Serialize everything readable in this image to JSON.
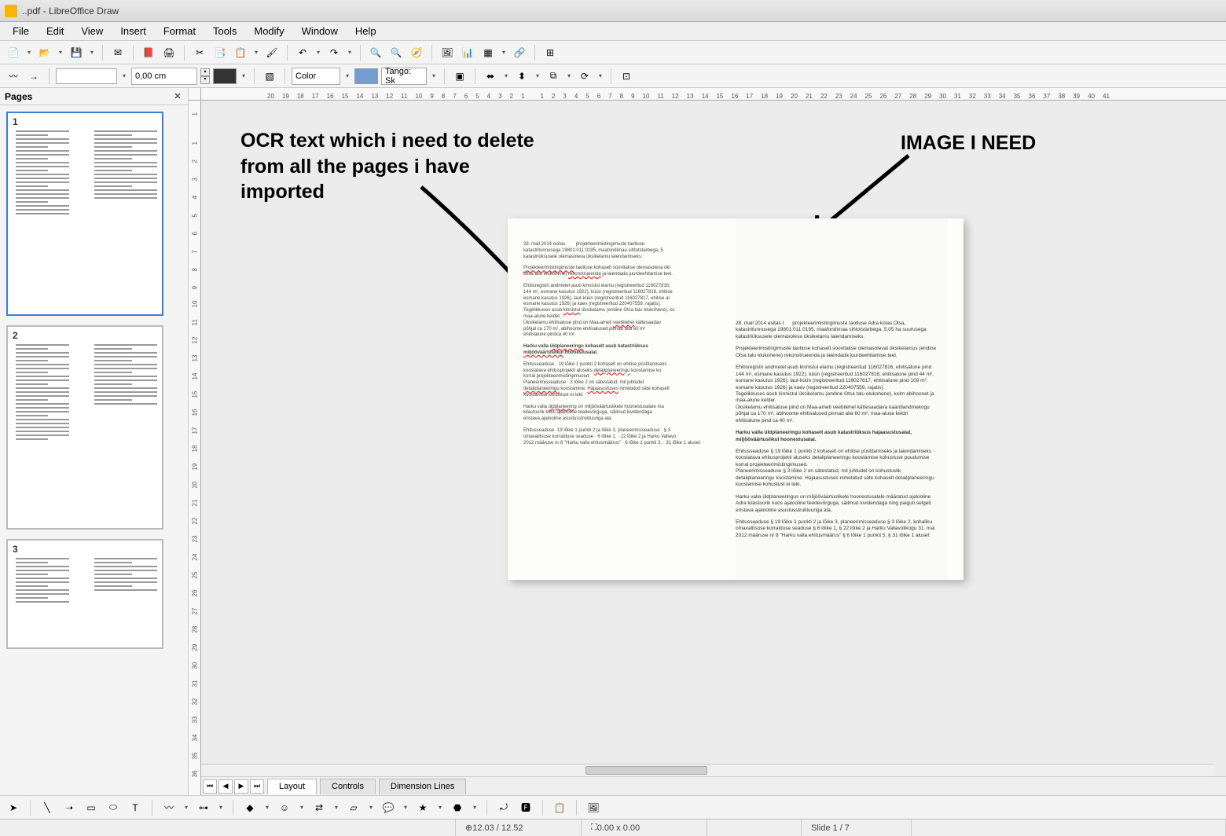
{
  "window": {
    "title": "..pdf - LibreOffice Draw"
  },
  "menu": [
    "File",
    "Edit",
    "View",
    "Insert",
    "Format",
    "Tools",
    "Modify",
    "Window",
    "Help"
  ],
  "toolbar2": {
    "line_width": "0,00 cm",
    "fill_type": "Color",
    "fill_name": "Tango: Sk",
    "fill_color": "#729fcf"
  },
  "pages_panel": {
    "title": "Pages",
    "page_numbers": [
      "1",
      "2",
      "3"
    ]
  },
  "ruler_h": [
    "20",
    "19",
    "18",
    "17",
    "16",
    "15",
    "14",
    "13",
    "12",
    "11",
    "10",
    "9",
    "8",
    "7",
    "6",
    "5",
    "4",
    "3",
    "2",
    "1",
    "",
    "1",
    "2",
    "3",
    "4",
    "5",
    "6",
    "7",
    "8",
    "9",
    "10",
    "11",
    "12",
    "13",
    "14",
    "15",
    "16",
    "17",
    "18",
    "19",
    "20",
    "21",
    "22",
    "23",
    "24",
    "25",
    "26",
    "27",
    "28",
    "29",
    "30",
    "31",
    "32",
    "33",
    "34",
    "35",
    "36",
    "37",
    "38",
    "39",
    "40",
    "41"
  ],
  "ruler_v": [
    "1",
    "",
    "1",
    "2",
    "3",
    "4",
    "5",
    "6",
    "7",
    "8",
    "9",
    "10",
    "11",
    "12",
    "13",
    "14",
    "15",
    "16",
    "17",
    "18",
    "19",
    "20",
    "21",
    "22",
    "23",
    "24",
    "25",
    "26",
    "27",
    "28",
    "29",
    "30",
    "31",
    "32",
    "33",
    "34",
    "35",
    "36"
  ],
  "annotations": {
    "left": "OCR text which i need to delete from all the pages i have imported",
    "right": "IMAGE I NEED"
  },
  "tabs": [
    "Layout",
    "Controls",
    "Dimension Lines"
  ],
  "status": {
    "pos": "12.03 / 12.52",
    "size": "0.00 x 0.00",
    "slide": "Slide 1 / 7"
  },
  "icons": {
    "new": "📄",
    "open": "📂",
    "save": "💾",
    "mail": "✉",
    "pdf": "📕",
    "print": "🖨",
    "cut": "✂",
    "copy": "📑",
    "paste": "📋",
    "fmtbrush": "🖌",
    "undo": "↶",
    "redo": "↷",
    "find": "🔍",
    "zoom": "🔍",
    "nav": "🧭",
    "img": "🖼",
    "chart": "📊",
    "table": "▦",
    "link": "🔗",
    "grid": "⊞",
    "lstyle": "〰",
    "arrowend": "→",
    "shadow": "▧",
    "align": "⬌",
    "order": "⬍",
    "group": "⧉",
    "rotate": "⟳",
    "checker": "▣",
    "pointer": "➤",
    "line": "╲",
    "arrow": "➝",
    "rect": "▭",
    "ellipse": "⬭",
    "txt": "T",
    "curve": "〰",
    "conn": "⊶",
    "shapes": "◆",
    "star": "★",
    "smile": "☺",
    "eqarrow": "⇄",
    "flow": "▱",
    "call": "💬",
    "3d": "⬣",
    "toggle": "⤾",
    "fw": "🅵",
    "clip": "📋",
    "gal": "🖼",
    "slide": "▶"
  }
}
